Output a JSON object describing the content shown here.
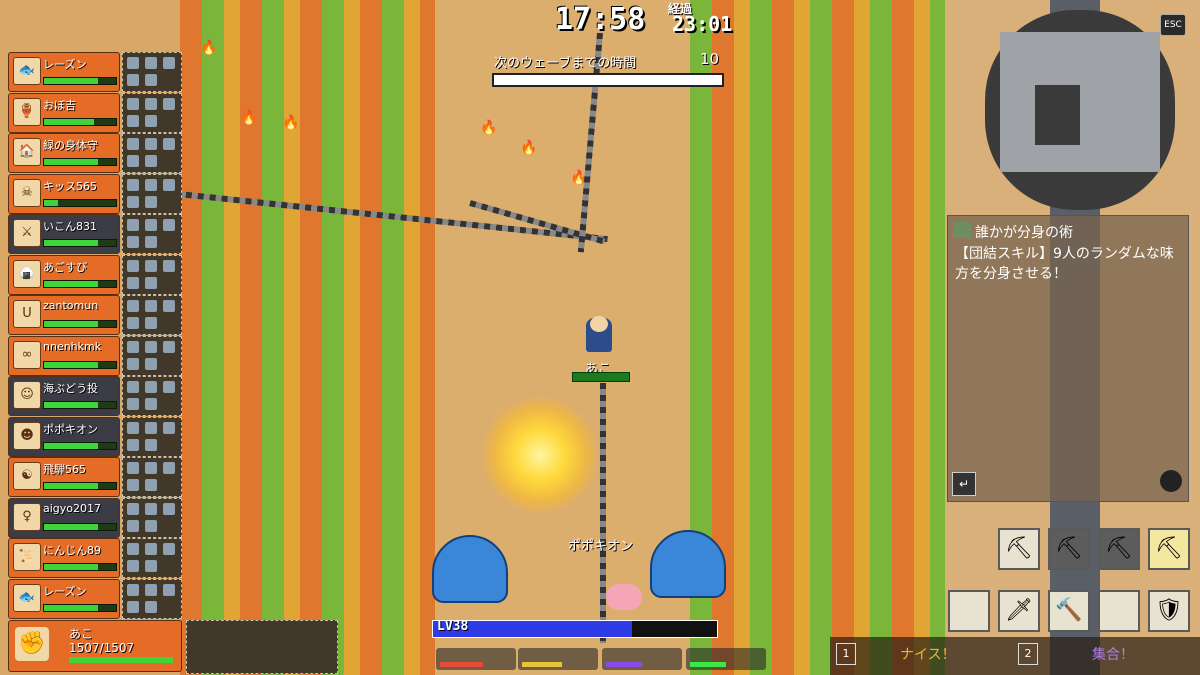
{
  "hud": {
    "timer": "17:58",
    "elapsed_label": "経過",
    "elapsed": "23:01",
    "wave_label": "次のウェーブまでの時間",
    "wave_seconds": "10",
    "wave_progress": 1.0,
    "esc_label": "ESC"
  },
  "players": [
    {
      "name": "レーズン",
      "icon": "fish-icon",
      "hp": 0.75,
      "dark": false
    },
    {
      "name": "おぼ吉",
      "icon": "jar-icon",
      "hp": 0.7,
      "dark": false
    },
    {
      "name": "緑の身体守",
      "icon": "house-icon",
      "hp": 0.75,
      "dark": false
    },
    {
      "name": "キッス565",
      "icon": "skull-jar-icon",
      "hp": 0.2,
      "dark": false
    },
    {
      "name": "いこん831",
      "icon": "warrior-icon",
      "hp": 0.75,
      "dark": true
    },
    {
      "name": "あごすび",
      "icon": "rice-ball-icon",
      "hp": 0.75,
      "dark": false
    },
    {
      "name": "zantomun",
      "icon": "magnet-icon",
      "hp": 0.75,
      "dark": false
    },
    {
      "name": "nnenhkmk",
      "icon": "rope-icon",
      "hp": 0.75,
      "dark": false
    },
    {
      "name": "海ぶどう投",
      "icon": "monk-icon",
      "hp": 0.75,
      "dark": true
    },
    {
      "name": "ポポキオン",
      "icon": "baby-icon",
      "hp": 0.75,
      "dark": true
    },
    {
      "name": "飛騨565",
      "icon": "yin-yang-icon",
      "hp": 0.75,
      "dark": false
    },
    {
      "name": "aigyo2017",
      "icon": "girl-icon",
      "hp": 0.75,
      "dark": true
    },
    {
      "name": "にんじん89",
      "icon": "scroll-icon",
      "hp": 0.75,
      "dark": false
    },
    {
      "name": "レーズン",
      "icon": "fish-icon",
      "hp": 0.75,
      "dark": false
    }
  ],
  "me": {
    "name": "あこ",
    "hp_text": "1507/1507",
    "hp": 1.0,
    "icon": "fist-icon"
  },
  "character": {
    "name": "あこ",
    "other_name": "ポポキオン"
  },
  "level": {
    "label": "LV38",
    "progress": 0.7
  },
  "skills": [
    {
      "icon": "hat-icon",
      "cooldown": 0.6,
      "color": "#e84a3a"
    },
    {
      "icon": "hat-icon",
      "cooldown": 0.55,
      "color": "#e8c43a"
    },
    {
      "icon": "box-icon",
      "cooldown": 0.5,
      "color": "#8a4ae8"
    },
    {
      "icon": "hat-icon",
      "cooldown": 0.5,
      "color": "#3ae84a"
    }
  ],
  "log": {
    "title": "誰かが分身の術",
    "body": "【団結スキル】9人のランダムな味方を分身させる！",
    "enter_label": "↵"
  },
  "weapons": [
    {
      "icon": "pickaxe-icon",
      "glyph": "⛏",
      "style": "normal"
    },
    {
      "icon": "pickaxe-icon",
      "glyph": "⛏",
      "style": "dark"
    },
    {
      "icon": "pickaxe-icon",
      "glyph": "⛏",
      "style": "dark"
    },
    {
      "icon": "pickaxe-icon",
      "glyph": "⛏",
      "style": "gold"
    },
    {
      "icon": "empty-slot-icon",
      "glyph": "",
      "style": "normal"
    },
    {
      "icon": "sword-icon",
      "glyph": "🗡",
      "style": "normal"
    },
    {
      "icon": "hammer-icon",
      "glyph": "🔨",
      "style": "normal"
    },
    {
      "icon": "empty-slot-icon",
      "glyph": "",
      "style": "normal"
    },
    {
      "icon": "shield-icon",
      "glyph": "🛡",
      "style": "normal"
    }
  ],
  "stamps": [
    {
      "key": "1",
      "label": "ナイス！",
      "color": "#f0b43a"
    },
    {
      "key": "2",
      "label": "集合！",
      "color": "#b07ae8"
    }
  ],
  "colors": {
    "hud_orange": "#e46c27",
    "hp_green": "#3fd43a",
    "level_blue": "#2f3ce6"
  }
}
